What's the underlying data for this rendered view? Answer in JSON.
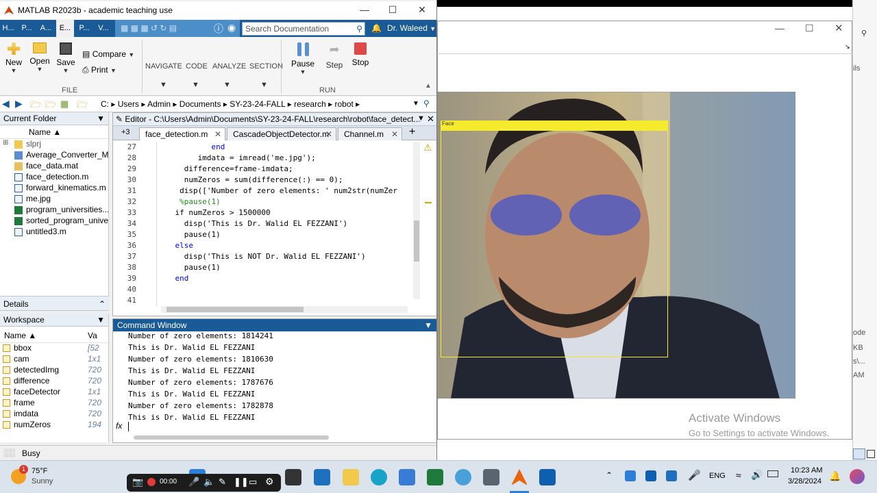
{
  "window": {
    "title": "MATLAB R2023b - academic teaching use",
    "tabs": [
      "H...",
      "P...",
      "A...",
      "E...",
      "P...",
      "V..."
    ],
    "search_placeholder": "Search Documentation",
    "user": "Dr. Waleed"
  },
  "toolstrip": {
    "new": "New",
    "open": "Open",
    "save": "Save",
    "compare": "Compare",
    "print": "Print",
    "file_group": "FILE",
    "navigate": "NAVIGATE",
    "code": "CODE",
    "analyze": "ANALYZE",
    "section": "SECTION",
    "pause": "Pause",
    "step": "Step",
    "stop": "Stop",
    "run_group": "RUN"
  },
  "path": {
    "segments": [
      "C:",
      "Users",
      "Admin",
      "Documents",
      "SY-23-24-FALL",
      "research",
      "robot"
    ]
  },
  "current_folder": {
    "title": "Current Folder",
    "column": "Name",
    "files": [
      "slprj",
      "Average_Converter_M...",
      "face_data.mat",
      "face_detection.m",
      "forward_kinematics.m",
      "me.jpg",
      "program_universities....",
      "sorted_program_unive...",
      "untitled3.m"
    ]
  },
  "details": {
    "title": "Details"
  },
  "workspace": {
    "title": "Workspace",
    "col_name": "Name",
    "col_value": "Va",
    "vars": [
      {
        "name": "bbox",
        "value": "[52"
      },
      {
        "name": "cam",
        "value": "1x1"
      },
      {
        "name": "detectedImg",
        "value": "720"
      },
      {
        "name": "difference",
        "value": "720"
      },
      {
        "name": "faceDetector",
        "value": "1x1"
      },
      {
        "name": "frame",
        "value": "720"
      },
      {
        "name": "imdata",
        "value": "720"
      },
      {
        "name": "numZeros",
        "value": "194"
      }
    ]
  },
  "editor": {
    "header": "Editor - C:\\Users\\Admin\\Documents\\SY-23-24-FALL\\research\\robot\\face_detect...",
    "tabs": [
      "face_detection.m",
      "CascadeObjectDetector.m",
      "Channel.m"
    ],
    "tab_count": "+3",
    "lines": [
      {
        "n": "27",
        "code": "            end"
      },
      {
        "n": "28",
        "code": "         imdata = imread('me.jpg');"
      },
      {
        "n": "29",
        "code": "      difference=frame-imdata;"
      },
      {
        "n": "30",
        "code": "      numZeros = sum(difference(:) == 0);"
      },
      {
        "n": "31",
        "code": "     disp(['Number of zero elements: ' num2str(numZer"
      },
      {
        "n": "32",
        "code": "     %pause(1)"
      },
      {
        "n": "33",
        "code": "    if numZeros > 1500000"
      },
      {
        "n": "34",
        "code": "      disp('This is Dr. Walid EL FEZZANI')"
      },
      {
        "n": "35",
        "code": "      pause(1)"
      },
      {
        "n": "36",
        "code": "    else"
      },
      {
        "n": "37",
        "code": "      disp('This is NOT Dr. Walid EL FEZZANI')"
      },
      {
        "n": "38",
        "code": "      pause(1)"
      },
      {
        "n": "39",
        "code": "    end"
      },
      {
        "n": "40",
        "code": ""
      },
      {
        "n": "41",
        "code": ""
      }
    ]
  },
  "command_window": {
    "title": "Command Window",
    "lines": [
      "Number of zero elements: 1814241",
      "This is Dr. Walid EL FEZZANI",
      "Number of zero elements: 1810630",
      "This is Dr. Walid EL FEZZANI",
      "Number of zero elements: 1787676",
      "This is Dr. Walid EL FEZZANI",
      "Number of zero elements: 1782878",
      "This is Dr. Walid EL FEZZANI"
    ],
    "prompt": "fx"
  },
  "status": {
    "text": "Busy"
  },
  "video": {
    "label": "Face"
  },
  "activate": {
    "title": "Activate Windows",
    "subtitle": "Go to Settings to activate Windows."
  },
  "side_fragments": [
    "ils",
    "ode",
    "KB",
    "s\\...",
    "AM"
  ],
  "taskbar": {
    "weather_temp": "75°F",
    "weather_desc": "Sunny",
    "badge": "1",
    "cam_time": "00:00",
    "lang": "ENG",
    "time": "10:23 AM",
    "date": "3/28/2024"
  }
}
